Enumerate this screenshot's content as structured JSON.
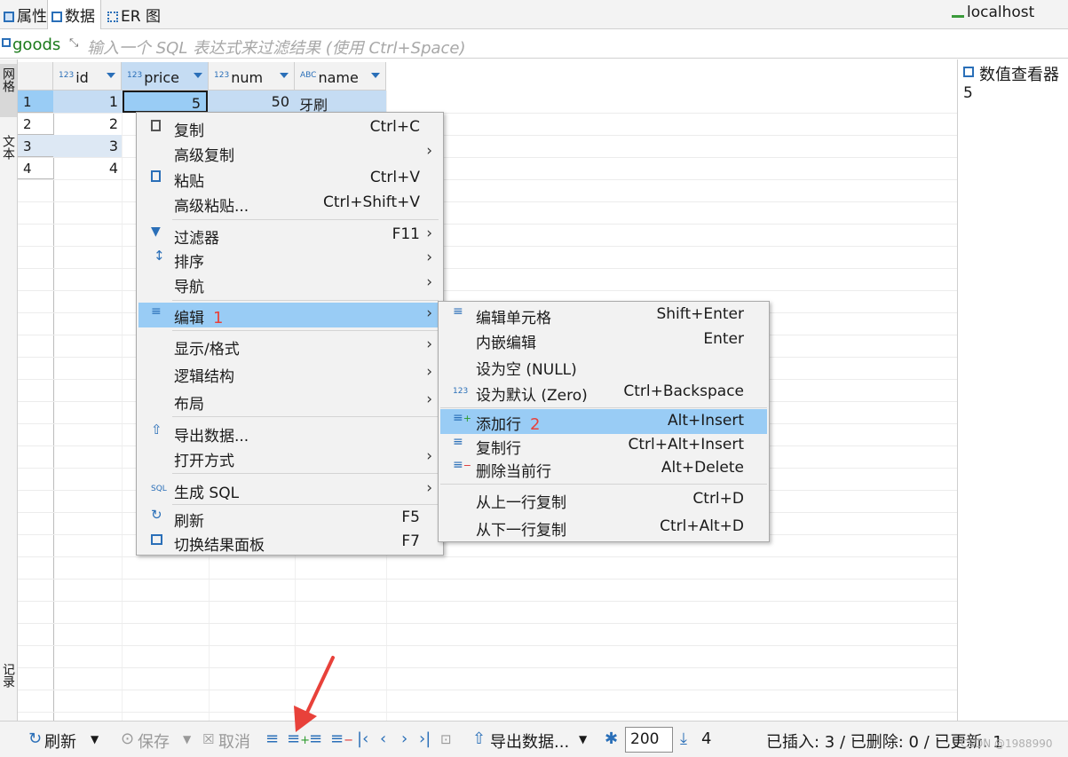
{
  "tabs": [
    "属性",
    "数据",
    "ER 图"
  ],
  "connection": "localhost",
  "filter": {
    "table_name": "goods",
    "placeholder": "输入一个 SQL 表达式来过滤结果 (使用 Ctrl+Space)"
  },
  "left_strip_labels": [
    "网格",
    "文本",
    "记录"
  ],
  "grid": {
    "columns": [
      {
        "type": "123",
        "name": "id"
      },
      {
        "type": "123",
        "name": "price"
      },
      {
        "type": "123",
        "name": "num"
      },
      {
        "type": "ABC",
        "name": "name"
      }
    ],
    "rows": [
      {
        "rownum": "1",
        "id": "1",
        "price": "5",
        "num": "50",
        "name": "牙刷"
      },
      {
        "rownum": "2",
        "id": "2"
      },
      {
        "rownum": "3",
        "id": "3"
      },
      {
        "rownum": "4",
        "id": "4"
      }
    ]
  },
  "value_viewer": {
    "title": "数值查看器",
    "value": "5"
  },
  "context_menu": {
    "items": [
      {
        "label": "复制",
        "shortcut": "Ctrl+C",
        "icon": "copy-icon"
      },
      {
        "label": "高级复制",
        "submenu": true
      },
      {
        "label": "粘贴",
        "shortcut": "Ctrl+V",
        "icon": "paste-icon"
      },
      {
        "label": "高级粘贴...",
        "shortcut": "Ctrl+Shift+V"
      },
      {
        "label": "过滤器",
        "shortcut": "F11",
        "icon": "filter-icon",
        "submenu": true
      },
      {
        "label": "排序",
        "icon": "sort-icon",
        "submenu": true
      },
      {
        "label": "导航",
        "submenu": true
      },
      {
        "label": "编辑",
        "icon": "edit-icon",
        "submenu": true,
        "badge": "1"
      },
      {
        "label": "显示/格式",
        "submenu": true
      },
      {
        "label": "逻辑结构",
        "submenu": true
      },
      {
        "label": "布局",
        "submenu": true
      },
      {
        "label": "导出数据...",
        "icon": "export-icon"
      },
      {
        "label": "打开方式",
        "submenu": true
      },
      {
        "label": "生成 SQL",
        "icon": "sql-icon",
        "submenu": true
      },
      {
        "label": "刷新",
        "shortcut": "F5",
        "icon": "refresh-icon"
      },
      {
        "label": "切换结果面板",
        "shortcut": "F7",
        "icon": "panel-icon"
      }
    ],
    "submenu_arrow": "›"
  },
  "edit_submenu": {
    "items": [
      {
        "label": "编辑单元格",
        "shortcut": "Shift+Enter",
        "icon": "edit-cell-icon"
      },
      {
        "label": "内嵌编辑",
        "shortcut": "Enter"
      },
      {
        "label": "设为空 (NULL)"
      },
      {
        "label": "设为默认 (Zero)",
        "shortcut": "Ctrl+Backspace",
        "icon": "123"
      },
      {
        "label": "添加行",
        "shortcut": "Alt+Insert",
        "icon": "add-row-icon",
        "badge": "2"
      },
      {
        "label": "复制行",
        "shortcut": "Ctrl+Alt+Insert",
        "icon": "duplicate-row-icon"
      },
      {
        "label": "删除当前行",
        "shortcut": "Alt+Delete",
        "icon": "delete-row-icon"
      },
      {
        "label": "从上一行复制",
        "shortcut": "Ctrl+D"
      },
      {
        "label": "从下一行复制",
        "shortcut": "Ctrl+Alt+D"
      }
    ]
  },
  "bottom_bar": {
    "refresh": "刷新",
    "save": "保存",
    "cancel": "取消",
    "export": "导出数据...",
    "fetch_size": "200",
    "row_count": "4",
    "status": "已插入: 3 / 已删除: 0 / 已更新: 1"
  },
  "watermark": "CSDN @1988990",
  "colors": {
    "accent": "#2a6fb8",
    "highlight": "#99ccf5",
    "badge": "#e8413a",
    "arrow": "#e8413a"
  }
}
